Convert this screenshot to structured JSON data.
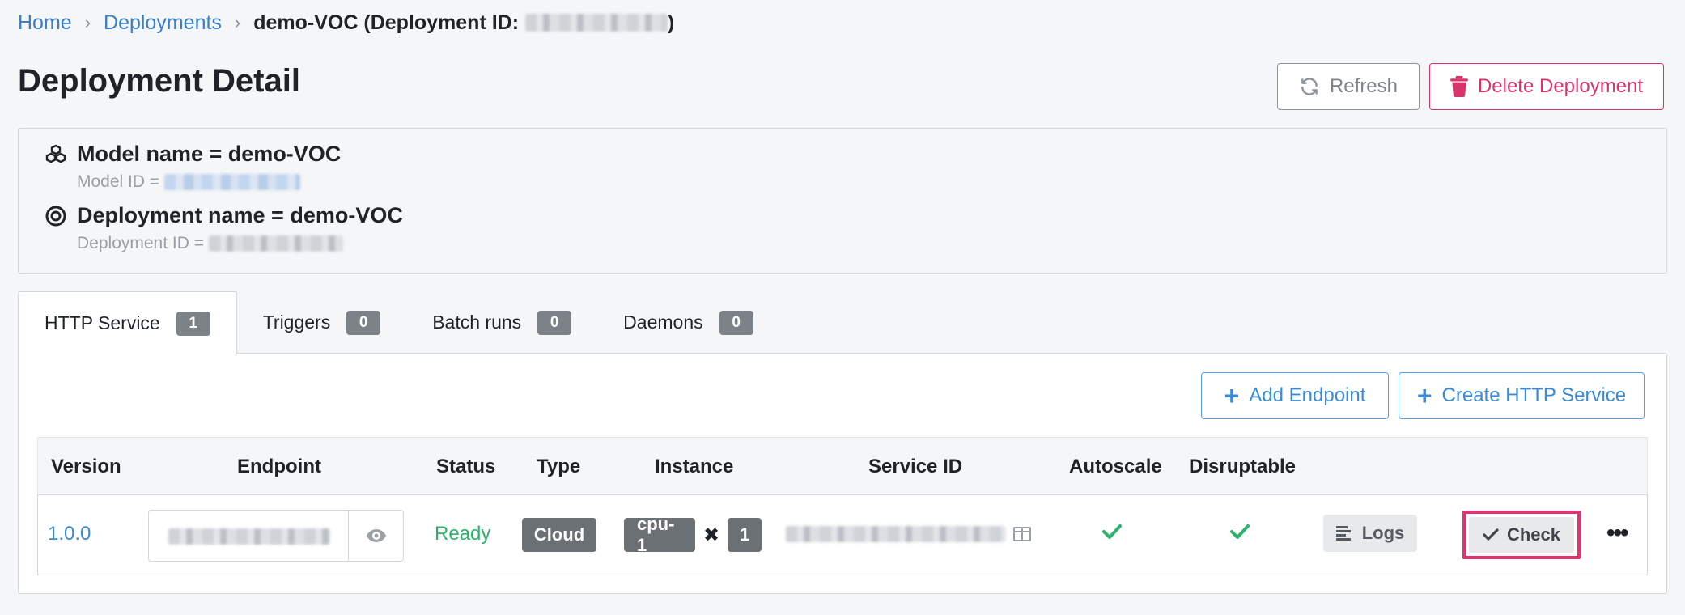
{
  "breadcrumb": {
    "home": "Home",
    "deployments": "Deployments",
    "current_prefix": "demo-VOC (Deployment ID:",
    "current_suffix": ")"
  },
  "page": {
    "title": "Deployment Detail",
    "refresh_label": "Refresh",
    "delete_label": "Delete Deployment"
  },
  "info": {
    "model_name": "Model name = demo-VOC",
    "model_id_label": "Model ID =",
    "deployment_name": "Deployment name = demo-VOC",
    "deployment_id_label": "Deployment ID ="
  },
  "tabs": [
    {
      "label": "HTTP Service",
      "count": "1"
    },
    {
      "label": "Triggers",
      "count": "0"
    },
    {
      "label": "Batch runs",
      "count": "0"
    },
    {
      "label": "Daemons",
      "count": "0"
    }
  ],
  "actions": {
    "add_endpoint": "Add Endpoint",
    "create_http_service": "Create HTTP Service"
  },
  "table": {
    "columns": [
      "Version",
      "Endpoint",
      "Status",
      "Type",
      "Instance",
      "Service ID",
      "Autoscale",
      "Disruptable"
    ],
    "rows": [
      {
        "version": "1.0.0",
        "status": "Ready",
        "type": "Cloud",
        "instance": "cpu-1",
        "instance_multiplier": "✖",
        "instance_count": "1",
        "logs_label": "Logs",
        "check_label": "Check",
        "more_label": "•••"
      }
    ]
  },
  "colors": {
    "link": "#3a7fc4",
    "danger": "#d8336b",
    "success": "#2db36b",
    "highlight": "#e5316f"
  }
}
